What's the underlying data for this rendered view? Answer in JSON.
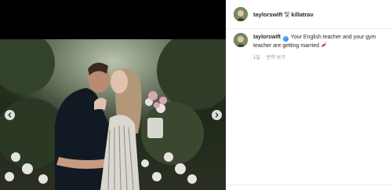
{
  "header": {
    "username": "taylorswift",
    "separator": "및",
    "collaborator": "killatrav"
  },
  "comment": {
    "username": "taylorswift",
    "text": "Your English teacher and your gym teacher are getting married",
    "time": "1일",
    "translate": "번역 보기"
  },
  "icons": {
    "prev": "chevron-left-icon",
    "next": "chevron-right-icon",
    "verified": "verified-icon",
    "emoji": "dynamite-icon"
  },
  "colors": {
    "verified": "#3897f0",
    "muted": "#8e8e8e",
    "text": "#262626"
  }
}
